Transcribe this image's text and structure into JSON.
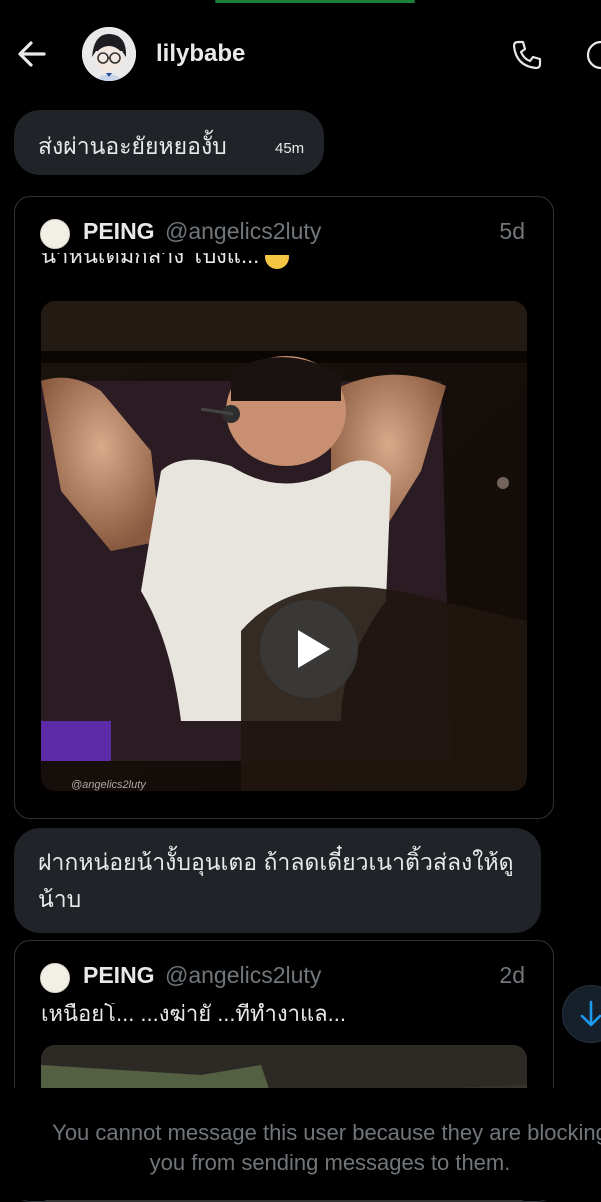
{
  "header": {
    "title": "lilybabe",
    "back_icon": "arrow-left-icon",
    "call_icon": "phone-icon",
    "info_icon": "info-icon"
  },
  "messages": [
    {
      "type": "text",
      "text": "ส่งผ่านอะยัยหยองั้บ",
      "time": "45m"
    },
    {
      "type": "shared_post",
      "author_name": "PEING",
      "author_handle": "@angelics2luty",
      "age": "5d",
      "text": "น้ำหนีเต็มกล้าง โป่งแ...",
      "media": "video",
      "watermark": "@angelics2luty"
    },
    {
      "type": "text",
      "text": "ฝากหน่อยน้างั้บอุนเตอ ถ้าลดเดี๋ยวเนาติ้วส่ลงให้ดูน้าบ"
    },
    {
      "type": "shared_post",
      "author_name": "PEING",
      "author_handle": "@angelics2luty",
      "age": "2d",
      "text": "เหนื่อยโ... ...งฆ่ายั ...ที่ทำงาแล..."
    }
  ],
  "footer": {
    "blocked_notice": "You cannot message this user because they are blocking you from sending messages to them."
  },
  "colors": {
    "background": "#000000",
    "bubble": "#202327",
    "card_border": "#2f3336",
    "muted_text": "#71767b",
    "accent": "#1d9bf0"
  }
}
